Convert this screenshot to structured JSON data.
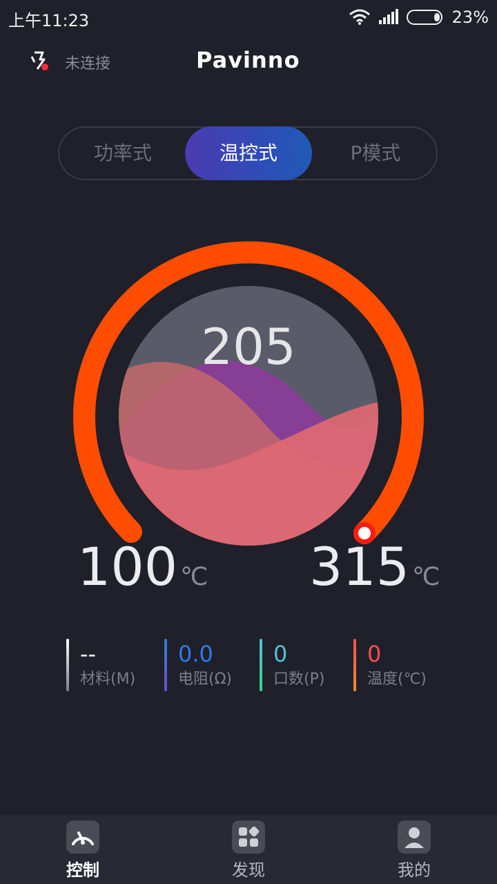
{
  "status_bar": {
    "time": "上午11:23",
    "battery": "23%",
    "icons": [
      "wifi-icon",
      "signal-icon",
      "battery-icon"
    ]
  },
  "header": {
    "connection_status": "未连接",
    "brand": "Pavinno",
    "icon": "disconnected-device-icon"
  },
  "modes": {
    "tabs": [
      "功率式",
      "温控式",
      "P模式"
    ],
    "selected": "温控式"
  },
  "dial": {
    "current_temp": "205",
    "min": "100",
    "max": "315",
    "unit": "℃",
    "arc_color": "#ff4d00"
  },
  "stats": [
    {
      "value": "--",
      "label": "材料(M)",
      "color": "#ffffff"
    },
    {
      "value": "0.0",
      "label": "电阻(Ω)",
      "color": "#2f7be8"
    },
    {
      "value": "0",
      "label": "口数(P)",
      "color": "#4fc3d9"
    },
    {
      "value": "0",
      "label": "温度(℃)",
      "color": "#ff4d4d"
    }
  ],
  "tabbar": {
    "items": [
      {
        "label": "控制",
        "icon": "gauge-icon"
      },
      {
        "label": "发现",
        "icon": "apps-icon"
      },
      {
        "label": "我的",
        "icon": "user-icon"
      }
    ],
    "selected": "控制"
  }
}
